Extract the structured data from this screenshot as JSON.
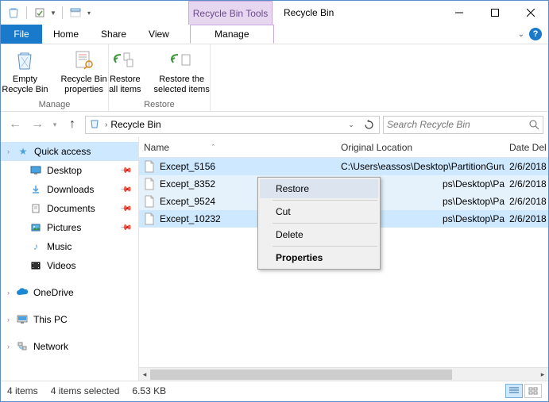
{
  "titlebar": {
    "tools_tab": "Recycle Bin Tools",
    "title": "Recycle Bin"
  },
  "tabs": {
    "file": "File",
    "home": "Home",
    "share": "Share",
    "view": "View",
    "manage": "Manage"
  },
  "ribbon": {
    "empty": "Empty\nRecycle Bin",
    "properties": "Recycle Bin\nproperties",
    "restore_all": "Restore\nall items",
    "restore_sel": "Restore the\nselected items",
    "group_manage": "Manage",
    "group_restore": "Restore"
  },
  "address": {
    "location": "Recycle Bin",
    "search_placeholder": "Search Recycle Bin"
  },
  "sidebar": {
    "items": [
      {
        "label": "Quick access"
      },
      {
        "label": "Desktop"
      },
      {
        "label": "Downloads"
      },
      {
        "label": "Documents"
      },
      {
        "label": "Pictures"
      },
      {
        "label": "Music"
      },
      {
        "label": "Videos"
      },
      {
        "label": "OneDrive"
      },
      {
        "label": "This PC"
      },
      {
        "label": "Network"
      }
    ]
  },
  "columns": {
    "name": "Name",
    "location": "Original Location",
    "date": "Date Del"
  },
  "files": [
    {
      "name": "Except_5156",
      "location": "C:\\Users\\eassos\\Desktop\\PartitionGuru",
      "date": "2/6/2018"
    },
    {
      "name": "Except_8352",
      "location": "ps\\Desktop\\PartitionGuru",
      "date": "2/6/2018"
    },
    {
      "name": "Except_9524",
      "location": "ps\\Desktop\\PartitionGuru",
      "date": "2/6/2018"
    },
    {
      "name": "Except_10232",
      "location": "ps\\Desktop\\PartitionGuru",
      "date": "2/6/2018"
    }
  ],
  "context_menu": {
    "restore": "Restore",
    "cut": "Cut",
    "delete": "Delete",
    "properties": "Properties"
  },
  "status": {
    "count": "4 items",
    "selected": "4 items selected",
    "size": "6.53 KB"
  }
}
